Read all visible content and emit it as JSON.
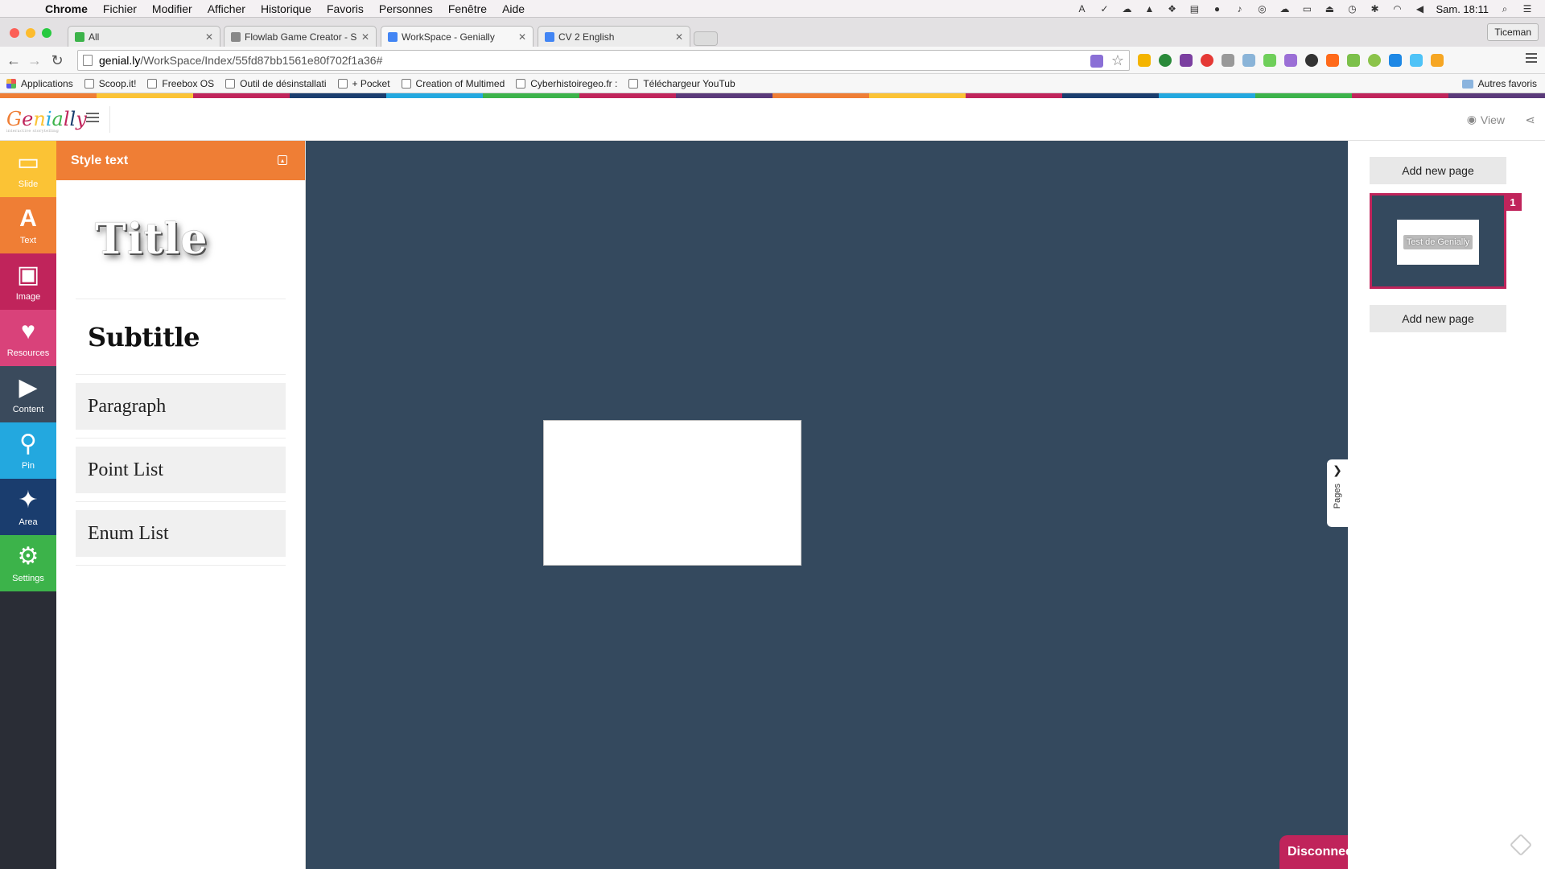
{
  "menubar": {
    "app_name": "Chrome",
    "items": [
      "Fichier",
      "Modifier",
      "Afficher",
      "Historique",
      "Favoris",
      "Personnes",
      "Fenêtre",
      "Aide"
    ],
    "clock": "Sam. 18:11"
  },
  "tabs": [
    {
      "label": "All",
      "favicon_color": "#3cb34a",
      "active": false
    },
    {
      "label": "Flowlab Game Creator - Sig",
      "favicon_color": "#888888",
      "active": false
    },
    {
      "label": "WorkSpace - Genially",
      "favicon_color": "#4285f4",
      "active": true
    },
    {
      "label": "CV 2 English",
      "favicon_color": "#4285f4",
      "active": false
    }
  ],
  "profile_name": "Ticeman",
  "address": {
    "host": "genial.ly",
    "path": "/WorkSpace/Index/55fd87bb1561e80f702f1a36#"
  },
  "bookmarks": [
    {
      "label": "Applications",
      "kind": "apps"
    },
    {
      "label": "Scoop.it!",
      "kind": "page"
    },
    {
      "label": "Freebox OS",
      "kind": "page"
    },
    {
      "label": "Outil de désinstallati",
      "kind": "page"
    },
    {
      "label": "+ Pocket",
      "kind": "page"
    },
    {
      "label": "Creation of Multimed",
      "kind": "page"
    },
    {
      "label": "Cyberhistoiregeo.fr :",
      "kind": "page"
    },
    {
      "label": "Téléchargeur YouTub",
      "kind": "page"
    }
  ],
  "bookmarks_other": "Autres favoris",
  "colors": {
    "accent_orange": "#ef7e35",
    "canvas_bg": "#34495e",
    "rail_bg": "#2a2d36",
    "brand_pink": "#c0245b",
    "stripe": [
      "#ef7e35",
      "#fbc335",
      "#c0245b",
      "#1a3d6e",
      "#23a8df",
      "#3cb34a",
      "#c0245b",
      "#5a3a7a"
    ]
  },
  "app_header": {
    "logo": "Genially",
    "logo_tagline": "interactive storytelling",
    "view_label": "View"
  },
  "rail": [
    {
      "label": "Slide",
      "icon": "slide-icon",
      "glyph": "▭",
      "bg": "#fbc335"
    },
    {
      "label": "Text",
      "icon": "text-icon",
      "glyph": "A",
      "bg": "#ef7e35"
    },
    {
      "label": "Image",
      "icon": "image-icon",
      "glyph": "▣",
      "bg": "#c0245b"
    },
    {
      "label": "Resources",
      "icon": "heart-icon",
      "glyph": "♥",
      "bg": "#d9427a"
    },
    {
      "label": "Content",
      "icon": "screen-play-icon",
      "glyph": "▶",
      "bg": "#3a4a5c"
    },
    {
      "label": "Pin",
      "icon": "pin-icon",
      "glyph": "⚲",
      "bg": "#23a8df"
    },
    {
      "label": "Area",
      "icon": "magic-wand-icon",
      "glyph": "✦",
      "bg": "#1a3d6e"
    },
    {
      "label": "Settings",
      "icon": "gear-icon",
      "glyph": "⚙",
      "bg": "#3cb34a"
    }
  ],
  "style_panel": {
    "header": "Style text",
    "title_sample": "Title",
    "subtitle_sample": "Subtitle",
    "boxes": [
      "Paragraph",
      "Point List",
      "Enum List"
    ]
  },
  "canvas": {
    "pages_tab_label": "Pages",
    "disconnect_label": "Disconnect"
  },
  "pages_panel": {
    "add_page_label": "Add new page",
    "thumb_number": "1",
    "thumb_text": "Test de Genially"
  }
}
